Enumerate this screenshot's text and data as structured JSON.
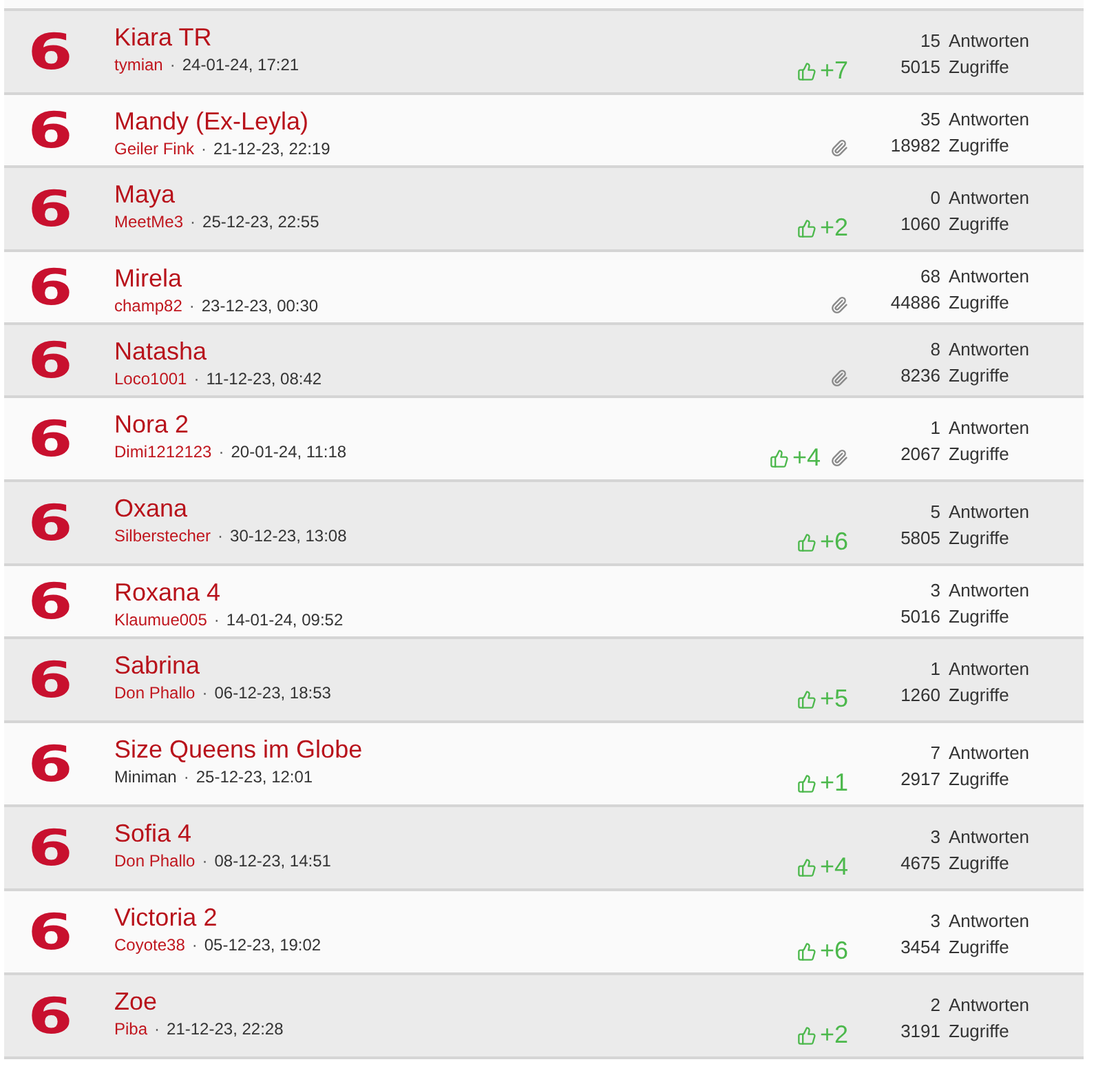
{
  "rows": [
    {
      "badge": "6",
      "title": "Kiara TR",
      "author": {
        "name": "tymian",
        "color": "#c0161e"
      },
      "separator": "·",
      "date": "24-01-24, 17:21",
      "likes": "+7",
      "attachment": false,
      "replies": "15",
      "replies_label": "Antworten",
      "views": "5015",
      "views_label": "Zugriffe"
    },
    {
      "badge": "6",
      "title": "Mandy (Ex-Leyla)",
      "author": {
        "name": "Geiler Fink",
        "color": "#c0161e"
      },
      "separator": "·",
      "date": "21-12-23, 22:19",
      "attachment": true,
      "replies": "35",
      "replies_label": "Antworten",
      "views": "18982",
      "views_label": "Zugriffe"
    },
    {
      "badge": "6",
      "title": "Maya",
      "author": {
        "name": "MeetMe3",
        "color": "#c0161e"
      },
      "separator": "·",
      "date": "25-12-23, 22:55",
      "likes": "+2",
      "attachment": false,
      "replies": "0",
      "replies_label": "Antworten",
      "views": "1060",
      "views_label": "Zugriffe"
    },
    {
      "badge": "6",
      "title": "Mirela",
      "author": {
        "name": "champ82",
        "color": "#c0161e"
      },
      "separator": "·",
      "date": "23-12-23, 00:30",
      "attachment": true,
      "replies": "68",
      "replies_label": "Antworten",
      "views": "44886",
      "views_label": "Zugriffe"
    },
    {
      "badge": "6",
      "title": "Natasha",
      "author": {
        "name": "Loco1001",
        "color": "#c0161e"
      },
      "separator": "·",
      "date": "11-12-23, 08:42",
      "attachment": true,
      "replies": "8",
      "replies_label": "Antworten",
      "views": "8236",
      "views_label": "Zugriffe"
    },
    {
      "badge": "6",
      "title": "Nora 2",
      "author": {
        "name": "Dimi1212123",
        "color": "#c0161e"
      },
      "separator": "·",
      "date": "20-01-24, 11:18",
      "likes": "+4",
      "attachment": true,
      "replies": "1",
      "replies_label": "Antworten",
      "views": "2067",
      "views_label": "Zugriffe"
    },
    {
      "badge": "6",
      "title": "Oxana",
      "author": {
        "name": "Silberstecher",
        "color": "#c0161e"
      },
      "separator": "·",
      "date": "30-12-23, 13:08",
      "likes": "+6",
      "attachment": false,
      "replies": "5",
      "replies_label": "Antworten",
      "views": "5805",
      "views_label": "Zugriffe"
    },
    {
      "badge": "6",
      "title": "Roxana 4",
      "author": {
        "name": "Klaumue005",
        "color": "#c0161e"
      },
      "separator": "·",
      "date": "14-01-24, 09:52",
      "attachment": false,
      "replies": "3",
      "replies_label": "Antworten",
      "views": "5016",
      "views_label": "Zugriffe"
    },
    {
      "badge": "6",
      "title": "Sabrina",
      "author": {
        "name": "Don Phallo",
        "color": "#c0161e"
      },
      "separator": "·",
      "date": "06-12-23, 18:53",
      "likes": "+5",
      "attachment": false,
      "replies": "1",
      "replies_label": "Antworten",
      "views": "1260",
      "views_label": "Zugriffe"
    },
    {
      "badge": "6",
      "title": "Size Queens im Globe",
      "author": {
        "name": "Miniman",
        "color": "#333333"
      },
      "separator": "·",
      "date": "25-12-23, 12:01",
      "likes": "+1",
      "attachment": false,
      "replies": "7",
      "replies_label": "Antworten",
      "views": "2917",
      "views_label": "Zugriffe"
    },
    {
      "badge": "6",
      "title": "Sofia 4",
      "author": {
        "name": "Don Phallo",
        "color": "#c0161e"
      },
      "separator": "·",
      "date": "08-12-23, 14:51",
      "likes": "+4",
      "attachment": false,
      "replies": "3",
      "replies_label": "Antworten",
      "views": "4675",
      "views_label": "Zugriffe"
    },
    {
      "badge": "6",
      "title": "Victoria 2",
      "author": {
        "name": "Coyote38",
        "color": "#c0161e"
      },
      "separator": "·",
      "date": "05-12-23, 19:02",
      "likes": "+6",
      "attachment": false,
      "replies": "3",
      "replies_label": "Antworten",
      "views": "3454",
      "views_label": "Zugriffe"
    },
    {
      "badge": "6",
      "title": "Zoe",
      "author": {
        "name": "Piba",
        "color": "#c0161e"
      },
      "separator": "·",
      "date": "21-12-23, 22:28",
      "likes": "+2",
      "attachment": false,
      "replies": "2",
      "replies_label": "Antworten",
      "views": "3191",
      "views_label": "Zugriffe"
    }
  ]
}
